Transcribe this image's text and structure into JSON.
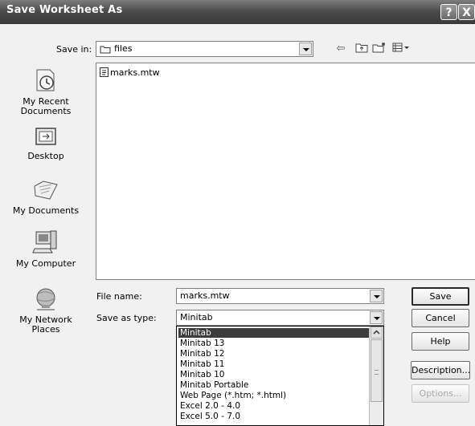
{
  "window": {
    "title": "Save Worksheet As",
    "help_glyph": "?",
    "close_glyph": "X"
  },
  "save_in": {
    "label": "Save in:",
    "value": "files",
    "icon": "folder-icon"
  },
  "toolbar": {
    "back_glyph": "⇦",
    "up_glyph": "⬑",
    "new_folder_glyph": "☆",
    "views_glyph": "▦▾"
  },
  "places": [
    {
      "label": "My Recent Documents",
      "icon": "recent-documents-icon"
    },
    {
      "label": "Desktop",
      "icon": "desktop-icon"
    },
    {
      "label": "My Documents",
      "icon": "my-documents-icon"
    },
    {
      "label": "My Computer",
      "icon": "my-computer-icon"
    },
    {
      "label": "My Network Places",
      "icon": "network-places-icon"
    }
  ],
  "files": [
    {
      "name": "marks.mtw",
      "icon": "worksheet-file-icon"
    }
  ],
  "file_name": {
    "label": "File name:",
    "value": "marks.mtw"
  },
  "save_as_type": {
    "label": "Save as type:",
    "value": "Minitab",
    "options": [
      "Minitab",
      "Minitab 13",
      "Minitab 12",
      "Minitab 11",
      "Minitab 10",
      "Minitab Portable",
      "Web Page (*.htm; *.html)",
      "Excel 2.0 - 4.0",
      "Excel 5.0 - 7.0"
    ],
    "selected_index": 0
  },
  "buttons": {
    "save": "Save",
    "cancel": "Cancel",
    "help": "Help",
    "description": "Description...",
    "options": "Options..."
  }
}
